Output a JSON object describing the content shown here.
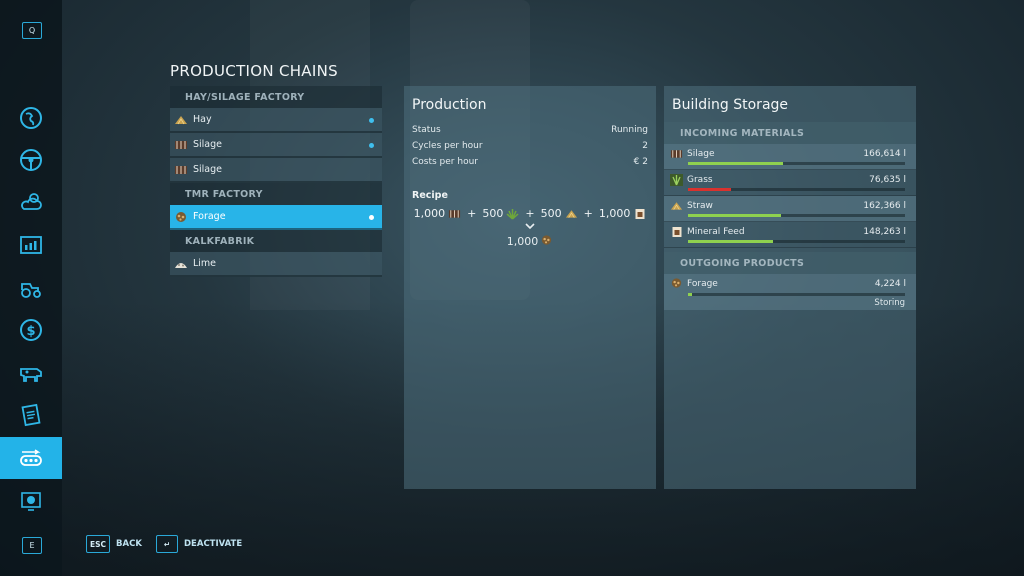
{
  "nav": {
    "top_key": "Q",
    "bottom_key": "E",
    "items": [
      {
        "icon": "map-globe-icon"
      },
      {
        "icon": "steering-wheel-icon"
      },
      {
        "icon": "weather-icon"
      },
      {
        "icon": "statistics-icon"
      },
      {
        "icon": "tractor-icon"
      },
      {
        "icon": "money-icon"
      },
      {
        "icon": "cow-icon"
      },
      {
        "icon": "contracts-icon"
      },
      {
        "icon": "production-chain-icon",
        "active": true
      },
      {
        "icon": "help-icon"
      }
    ]
  },
  "page": {
    "title": "PRODUCTION CHAINS"
  },
  "chains": {
    "categories": [
      {
        "name": "HAY/SILAGE FACTORY",
        "items": [
          {
            "label": "Hay"
          },
          {
            "label": "Silage"
          },
          {
            "label": "Silage"
          }
        ]
      },
      {
        "name": "TMR FACTORY",
        "items": [
          {
            "label": "Forage"
          }
        ]
      },
      {
        "name": "KALKFABRIK",
        "items": [
          {
            "label": "Lime"
          }
        ]
      }
    ]
  },
  "production": {
    "title": "Production",
    "rows": [
      {
        "label": "Status",
        "value": "Running"
      },
      {
        "label": "Cycles per hour",
        "value": "2"
      },
      {
        "label": "Costs per hour",
        "value": "€ 2"
      }
    ],
    "recipe_label": "Recipe",
    "inputs": [
      {
        "amount": "1,000",
        "icon": "silage-icon"
      },
      {
        "amount": "500",
        "icon": "grass-icon"
      },
      {
        "amount": "500",
        "icon": "straw-icon"
      },
      {
        "amount": "1,000",
        "icon": "mineral-feed-icon"
      }
    ],
    "plus": "+",
    "output": {
      "amount": "1,000",
      "icon": "forage-icon"
    }
  },
  "storage": {
    "title": "Building Storage",
    "incoming_label": "INCOMING MATERIALS",
    "incoming": [
      {
        "name": "Silage",
        "value": "166,614 l",
        "fill": 0.44,
        "color": "#8fd14f"
      },
      {
        "name": "Grass",
        "value": "76,635 l",
        "fill": 0.2,
        "color": "#d9322e"
      },
      {
        "name": "Straw",
        "value": "162,366 l",
        "fill": 0.43,
        "color": "#8fd14f"
      },
      {
        "name": "Mineral Feed",
        "value": "148,263 l",
        "fill": 0.39,
        "color": "#8fd14f"
      }
    ],
    "outgoing_label": "OUTGOING PRODUCTS",
    "outgoing": [
      {
        "name": "Forage",
        "value": "4,224 l",
        "fill": 0.02,
        "color": "#8fd14f",
        "state": "Storing"
      }
    ]
  },
  "hints": {
    "back_key": "ESC",
    "back_label": "BACK",
    "deactivate_key": "↵",
    "deactivate_label": "DEACTIVATE"
  }
}
